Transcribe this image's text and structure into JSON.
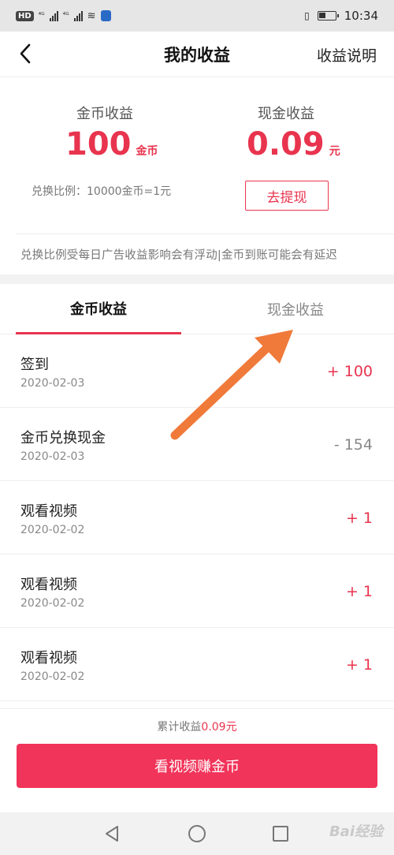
{
  "status_bar": {
    "hd": "HD",
    "sig1": "⁴ᴳ",
    "sig2": "⁴ᴳ",
    "time": "10:34"
  },
  "header": {
    "title": "我的收益",
    "help_link": "收益说明"
  },
  "summary": {
    "coin_label": "金币收益",
    "coin_value": "100",
    "coin_unit": "金币",
    "cash_label": "现金收益",
    "cash_value": "0.09",
    "cash_unit": "元",
    "ratio_text": "兑换比例：10000金币=1元",
    "withdraw_button": "去提现",
    "notice": "兑换比例受每日广告收益影响会有浮动|金币到账可能会有延迟"
  },
  "tabs": [
    {
      "label": "金币收益",
      "active": true
    },
    {
      "label": "现金收益",
      "active": false
    }
  ],
  "records": [
    {
      "title": "签到",
      "date": "2020-02-03",
      "amount": "+ 100",
      "sign": "plus"
    },
    {
      "title": "金币兑换现金",
      "date": "2020-02-03",
      "amount": "- 154",
      "sign": "minus"
    },
    {
      "title": "观看视频",
      "date": "2020-02-02",
      "amount": "+ 1",
      "sign": "plus"
    },
    {
      "title": "观看视频",
      "date": "2020-02-02",
      "amount": "+ 1",
      "sign": "plus"
    },
    {
      "title": "观看视频",
      "date": "2020-02-02",
      "amount": "+ 1",
      "sign": "plus"
    }
  ],
  "footer": {
    "total_label": "累计收益",
    "total_value": "0.09元",
    "cta_button": "看视频赚金币"
  },
  "watermark": "Bai经验",
  "colors": {
    "accent": "#e8344e",
    "cta": "#f1345a",
    "annotation_arrow": "#f07a3a"
  },
  "icons": {
    "back": "chevron-left-icon",
    "nav_back": "triangle-back-icon",
    "nav_home": "circle-home-icon",
    "nav_recent": "square-recent-icon"
  }
}
